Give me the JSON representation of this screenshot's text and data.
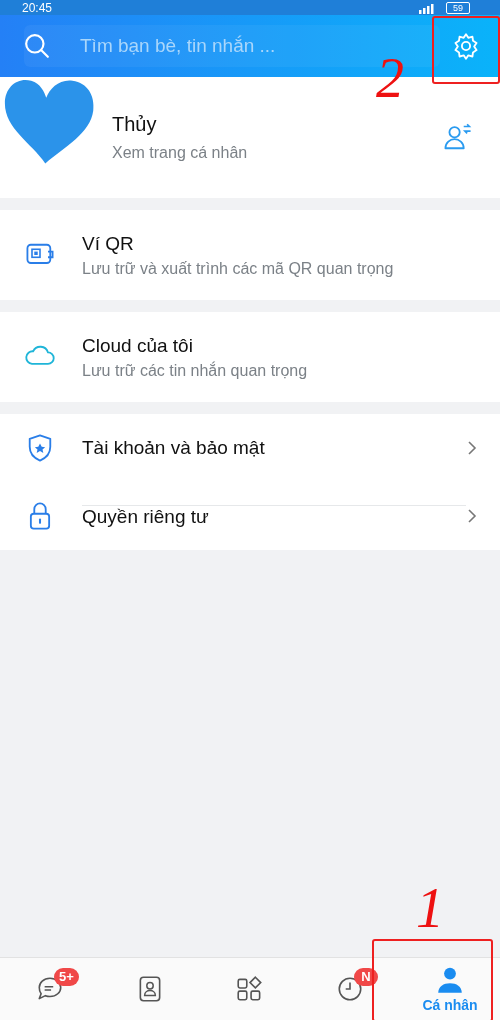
{
  "status_bar": {
    "time": "20:45",
    "battery": "59"
  },
  "header": {
    "search_placeholder": "Tìm bạn bè, tin nhắn ..."
  },
  "profile": {
    "name": "Thủy",
    "subtitle": "Xem trang cá nhân"
  },
  "sections": [
    {
      "items": [
        {
          "title": "Ví QR",
          "subtitle": "Lưu trữ và xuất trình các mã QR quan trọng"
        }
      ]
    },
    {
      "items": [
        {
          "title": "Cloud của tôi",
          "subtitle": "Lưu trữ các tin nhắn quan trọng"
        }
      ]
    },
    {
      "items": [
        {
          "title": "Tài khoản và bảo mật",
          "chevron": true
        },
        {
          "title": "Quyền riêng tư",
          "chevron": true
        }
      ]
    }
  ],
  "bottom_nav": [
    {
      "badge": "5+",
      "selected": false
    },
    {
      "selected": false
    },
    {
      "selected": false
    },
    {
      "badge": "N",
      "selected": false
    },
    {
      "label": "Cá nhân",
      "selected": true
    }
  ],
  "annotations": [
    {
      "number": "2"
    },
    {
      "number": "1"
    }
  ]
}
